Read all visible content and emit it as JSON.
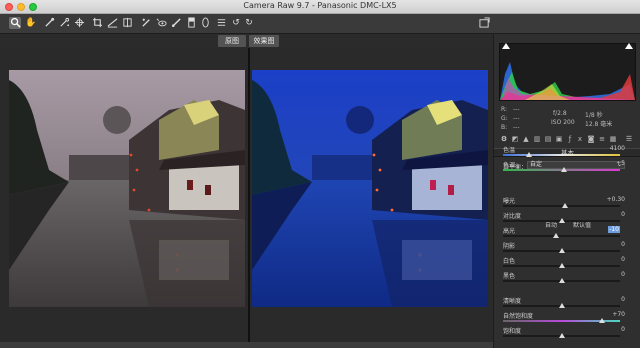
{
  "window": {
    "title": "Camera Raw 9.7  -  Panasonic DMC-LX5"
  },
  "view_tabs": {
    "before": "原图",
    "after": "效果图"
  },
  "readout": {
    "r_label": "R:",
    "r_val": "---",
    "g_label": "G:",
    "g_val": "---",
    "b_label": "B:",
    "b_val": "---",
    "aperture": "f/2.8",
    "shutter": "1/8 秒",
    "iso": "ISO 200",
    "focal": "12.8 毫米"
  },
  "panel": {
    "section_title": "基本"
  },
  "white_balance": {
    "label": "白平衡：",
    "value": "自定"
  },
  "auto_row": {
    "auto": "自动",
    "default": "默认值"
  },
  "sliders": [
    {
      "label": "色温",
      "value": "4100",
      "level": 0.22
    },
    {
      "label": "色调",
      "value": "+5",
      "level": 0.52
    },
    {
      "label": "曝光",
      "value": "+0.30",
      "level": 0.53
    },
    {
      "label": "对比度",
      "value": "0",
      "level": 0.5
    },
    {
      "label": "高光",
      "value": "-10",
      "level": 0.45
    },
    {
      "label": "阴影",
      "value": "0",
      "level": 0.5
    },
    {
      "label": "白色",
      "value": "0",
      "level": 0.5
    },
    {
      "label": "黑色",
      "value": "0",
      "level": 0.5
    },
    {
      "label": "清晰度",
      "value": "0",
      "level": 0.5
    },
    {
      "label": "自然饱和度",
      "value": "+70",
      "level": 0.85
    },
    {
      "label": "饱和度",
      "value": "0",
      "level": 0.5
    }
  ],
  "colors": {
    "accent": "#6f9ee0",
    "panel_bg": "#2f2f2f"
  }
}
